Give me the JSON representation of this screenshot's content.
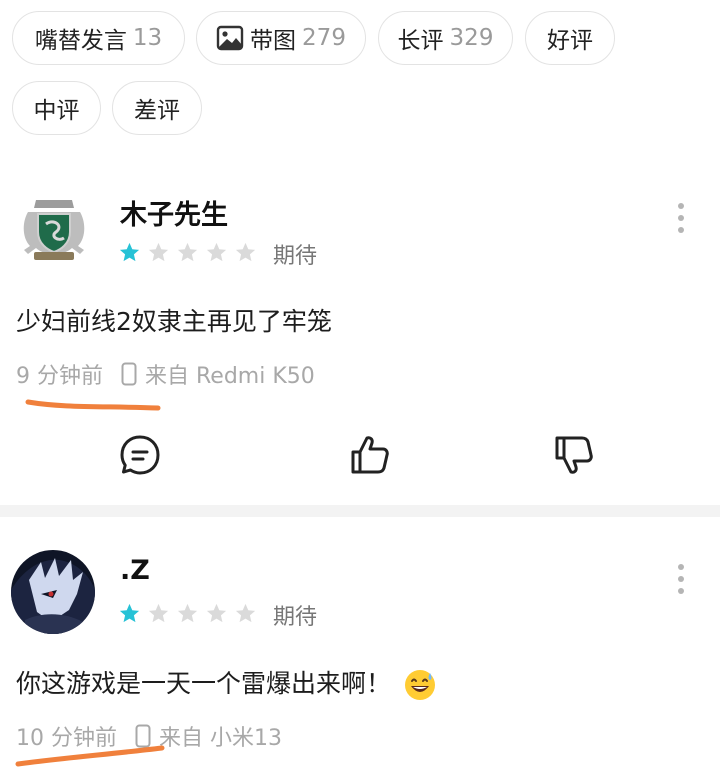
{
  "filters": [
    {
      "label": "嘴替发言",
      "count": "13",
      "icon": ""
    },
    {
      "label": "带图",
      "count": "279",
      "icon": "image-icon"
    },
    {
      "label": "长评",
      "count": "329",
      "icon": ""
    },
    {
      "label": "好评",
      "count": "",
      "icon": ""
    },
    {
      "label": "中评",
      "count": "",
      "icon": ""
    },
    {
      "label": "差评",
      "count": "",
      "icon": ""
    }
  ],
  "reviews": [
    {
      "username": "木子先生",
      "rating": 1,
      "max_rating": 5,
      "rating_label": "期待",
      "content": "少妇前线2奴隶主再见了牢笼",
      "time": "9 分钟前",
      "device": "来自 Redmi K50",
      "avatar": "house-crest-avatar"
    },
    {
      "username": ".Z",
      "rating": 1,
      "max_rating": 5,
      "rating_label": "期待",
      "content": "你这游戏是一天一个雷爆出来啊！",
      "content_emoji": "sweat-smile-emoji",
      "time": "10 分钟前",
      "device": "来自 小米13",
      "avatar": "anime-character-avatar"
    }
  ],
  "colors": {
    "star_active": "#27c2d6",
    "star_inactive": "#dadada",
    "annotation": "#f0803c",
    "muted_text": "#a8a8a8"
  }
}
